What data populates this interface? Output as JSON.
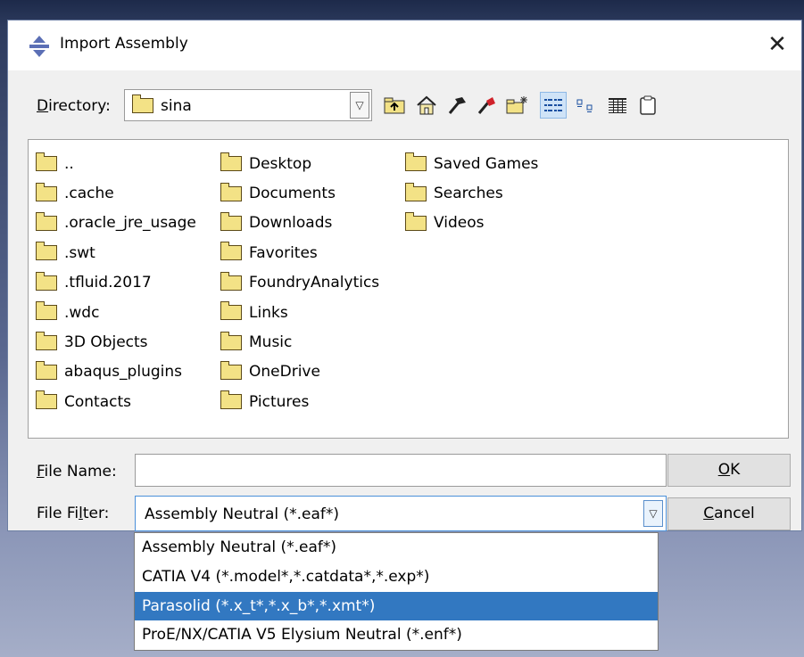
{
  "dialog": {
    "title": "Import Assembly",
    "title_icon": "move-arrows-icon",
    "close_glyph": "✕"
  },
  "directory": {
    "label_prefix": "",
    "label_accel": "D",
    "label_rest": "irectory:",
    "value": "sina"
  },
  "toolbar": {
    "icons": [
      "up-folder-icon",
      "home-icon",
      "hammer-icon",
      "bookmark-icon",
      "new-folder-icon",
      "list-view-icon",
      "icon-view-icon",
      "details-view-icon",
      "clipboard-icon"
    ]
  },
  "files": {
    "col1": [
      "..",
      ".cache",
      ".oracle_jre_usage",
      ".swt",
      ".tfluid.2017",
      ".wdc",
      "3D Objects",
      "abaqus_plugins",
      "Contacts"
    ],
    "col2": [
      "Desktop",
      "Documents",
      "Downloads",
      "Favorites",
      "FoundryAnalytics",
      "Links",
      "Music",
      "OneDrive",
      "Pictures"
    ],
    "col3": [
      "Saved Games",
      "Searches",
      "Videos"
    ]
  },
  "file_name": {
    "label_accel": "F",
    "label_rest": "ile Name:",
    "value": ""
  },
  "file_filter": {
    "label_prefix": "File Fi",
    "label_accel": "l",
    "label_rest": "ter:",
    "value": "Assembly Neutral (*.eaf*)",
    "options": [
      "Assembly Neutral (*.eaf*)",
      "CATIA V4 (*.model*,*.catdata*,*.exp*)",
      "Parasolid (*.x_t*,*.x_b*,*.xmt*)",
      "ProE/NX/CATIA V5 Elysium Neutral (*.enf*)"
    ],
    "highlighted_index": 2
  },
  "buttons": {
    "ok_accel": "O",
    "ok_rest": "K",
    "cancel_accel": "C",
    "cancel_rest": "ancel"
  },
  "colors": {
    "selection": "#3278c1",
    "folder_fill": "#f3e286"
  }
}
